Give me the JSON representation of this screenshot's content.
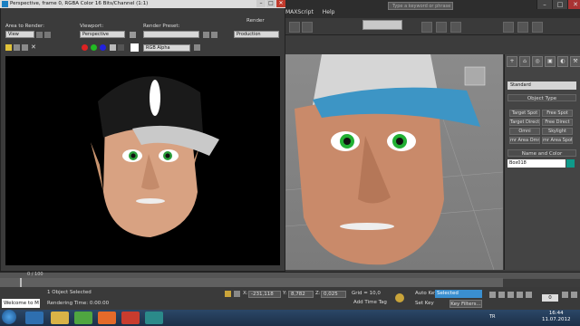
{
  "max": {
    "menu": [
      "MAXScript",
      "Help"
    ],
    "search_placeholder": "Type a keyword or phrase",
    "window_controls": [
      "–",
      "□",
      "✕"
    ]
  },
  "command_panel": {
    "tabs": [
      "+",
      "⌂",
      "◎",
      "▣",
      "◐",
      "⚒"
    ],
    "dropdown": "Standard",
    "object_type_title": "Object Type",
    "object_buttons": [
      "Target Spot",
      "Free Spot",
      "Target Direct",
      "Free Direct",
      "Omni",
      "Skylight",
      "mr Area Omni",
      "mr Area Spot"
    ],
    "name_color_title": "Name and Color",
    "name_value": "Box018",
    "swatch_color": "#0f9a8a"
  },
  "render_frame": {
    "title": "Perspective, frame 0, RGBA Color 16 Bits/Channel (1:1)",
    "area_label": "Area to Render:",
    "area_value": "View",
    "viewport_label": "Viewport:",
    "viewport_value": "Perspective",
    "preset_label": "Render Preset:",
    "render_label": "Render",
    "render_mode": "Production",
    "channel_value": "RGB Alpha",
    "controls": [
      "–",
      "□",
      "✕"
    ]
  },
  "timeline": {
    "slider_label": "0 / 100",
    "ticks": [
      "0",
      "10",
      "20",
      "30",
      "40",
      "50",
      "60",
      "70",
      "80",
      "90",
      "100"
    ]
  },
  "status": {
    "maxscript_text": "Welcome to M",
    "line1": "1 Object Selected",
    "line2": "Rendering Time: 0:00:00",
    "x_value": "-231,118",
    "y_value": "8,782",
    "z_value": "0,025",
    "grid": "Grid = 10,0",
    "auto_key": "Auto Key",
    "selected": "Selected",
    "set_key": "Set Key",
    "key_filters": "Key Filters...",
    "add_time_tag": "Add Time Tag",
    "frame": "0"
  },
  "taskbar": {
    "tray_lang": "TR",
    "time": "16:44",
    "date": "11.07.2012"
  }
}
